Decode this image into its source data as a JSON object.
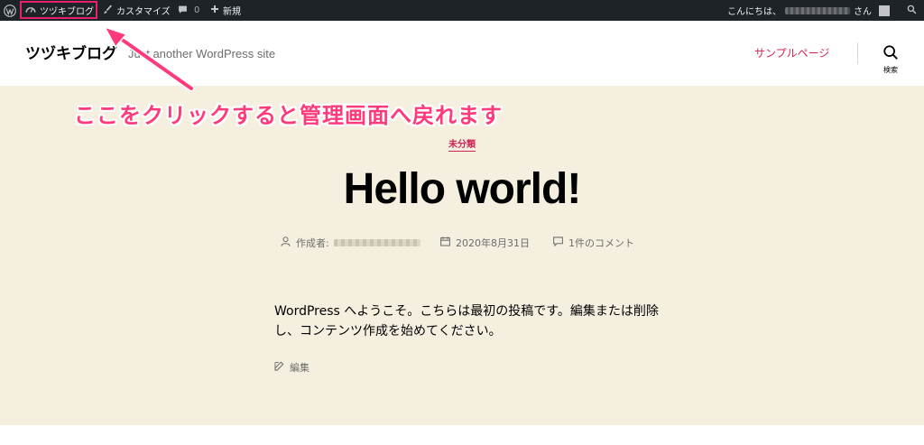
{
  "admin_bar": {
    "site_name": "ツヅキブログ",
    "customize": "カスタマイズ",
    "comments_count": "0",
    "new_label": "新規",
    "greeting_prefix": "こんにちは、",
    "greeting_suffix": "さん"
  },
  "header": {
    "site_title": "ツヅキブログ",
    "site_description": "Just another WordPress site",
    "nav_items": [
      "サンプルページ"
    ],
    "search_label": "検索"
  },
  "annotation": {
    "text": "ここをクリックすると管理画面へ戻れます",
    "color": "#ff3a7a"
  },
  "post": {
    "category": "未分類",
    "title": "Hello world!",
    "author_label": "作成者:",
    "date": "2020年8月31日",
    "comments": "1件のコメント",
    "content": "WordPress へようこそ。こちらは最初の投稿です。編集または削除し、コンテンツ作成を始めてください。",
    "edit_label": "編集"
  },
  "colors": {
    "admin_bar_bg": "#1d2327",
    "accent": "#cd2653",
    "hero_bg": "#f5efe0",
    "highlight_border": "#e8216f"
  },
  "icons": {
    "wp": "wordpress-logo-icon",
    "dashboard": "dashboard-gauge-icon",
    "customize": "paintbrush-icon",
    "comments": "speech-bubble-icon",
    "new": "plus-icon",
    "search": "search-icon",
    "author": "user-icon",
    "date": "calendar-icon",
    "comment": "comment-icon",
    "edit": "pencil-icon"
  }
}
